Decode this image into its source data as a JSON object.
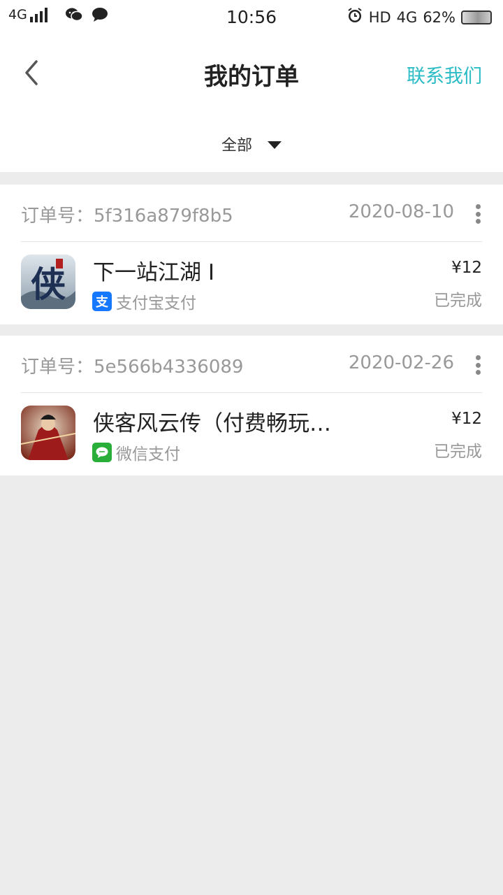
{
  "status_bar": {
    "network": "4G",
    "time": "10:56",
    "hd": "HD",
    "net_right": "4G",
    "battery": "62%"
  },
  "header": {
    "title": "我的订单",
    "contact_label": "联系我们"
  },
  "filter": {
    "selected": "全部"
  },
  "orders": [
    {
      "order_no": "订单号：5f316a879f8b5",
      "date": "2020-08-10",
      "game_name": "下一站江湖 Ⅰ",
      "pay_method": "支付宝支付",
      "pay_icon": "alipay-icon",
      "pay_color": "#1677ff",
      "price": "¥12",
      "status": "已完成"
    },
    {
      "order_no": "订单号：5e566b4336089",
      "date": "2020-02-26",
      "game_name": "侠客风云传（付费畅玩…",
      "pay_method": "微信支付",
      "pay_icon": "wechat-pay-icon",
      "pay_color": "#2aae3a",
      "price": "¥12",
      "status": "已完成"
    }
  ],
  "colors": {
    "accent": "#2bbcc6",
    "background": "#ececec"
  }
}
